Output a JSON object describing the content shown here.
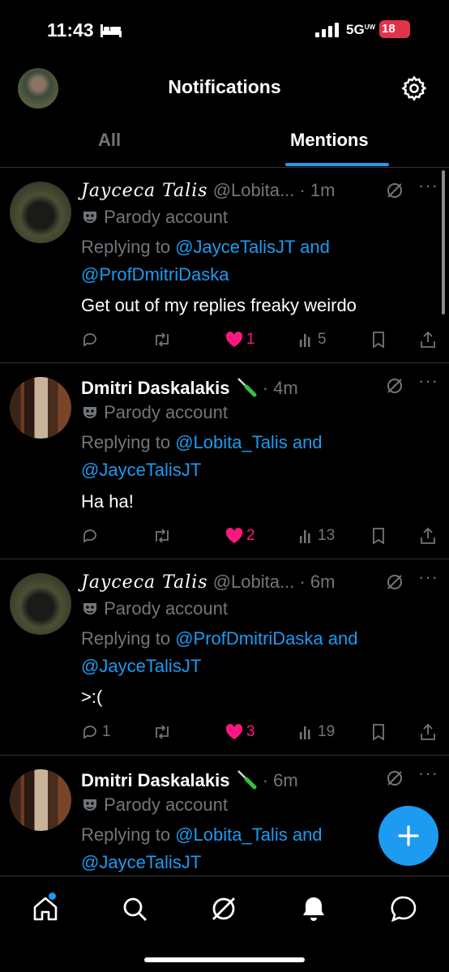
{
  "status_bar": {
    "time": "11:43",
    "network": "5G",
    "network_sub": "UW",
    "battery": "18"
  },
  "header": {
    "title": "Notifications"
  },
  "tabs": [
    {
      "label": "All"
    },
    {
      "label": "Mentions"
    }
  ],
  "tweets": [
    {
      "name": "Jayceca Talis",
      "handle": "@Lobita...",
      "time": "· 1m",
      "parody": "Parody account",
      "replying_prefix": "Replying to ",
      "mention_1": "@JayceTalisJT",
      "mention_and": " and",
      "mention_2": "@ProfDmitriDaska",
      "text": "Get out of my replies freaky weirdo",
      "replies": "",
      "likes": "1",
      "views": "5"
    },
    {
      "name": "Dmitri Daskalakis",
      "handle": "",
      "time": "· 4m",
      "parody": "Parody account",
      "replying_prefix": "Replying to ",
      "mention_1": "@Lobita_Talis",
      "mention_and": " and",
      "mention_2": "@JayceTalisJT",
      "text": "Ha ha!",
      "replies": "",
      "likes": "2",
      "views": "13"
    },
    {
      "name": "Jayceca Talis",
      "handle": "@Lobita...",
      "time": "· 6m",
      "parody": "Parody account",
      "replying_prefix": "Replying to ",
      "mention_1": "@ProfDmitriDaska",
      "mention_and": " and",
      "mention_2": "@JayceTalisJT",
      "text": ">:(",
      "replies": "1",
      "likes": "3",
      "views": "19"
    },
    {
      "name": "Dmitri Daskalakis",
      "handle": "",
      "time": "· 6m",
      "parody": "Parody account",
      "replying_prefix": "Replying to ",
      "mention_1": "@Lobita_Talis",
      "mention_and": " and",
      "mention_2": "@JayceTalisJT"
    }
  ],
  "more_label": "···",
  "colors": {
    "accent": "#1d9bf0",
    "like": "#f91880",
    "muted": "#71767b",
    "battery": "#e0344b"
  },
  "icons": [
    "bed-icon",
    "signal-icon",
    "gear-icon",
    "grok-icon",
    "more-icon",
    "reply-icon",
    "retweet-icon",
    "heart-icon",
    "views-icon",
    "bookmark-icon",
    "share-icon",
    "mask-icon",
    "screwdriver-icon",
    "home-icon",
    "search-icon",
    "grok-nav-icon",
    "bell-icon",
    "messages-icon",
    "plus-icon"
  ]
}
